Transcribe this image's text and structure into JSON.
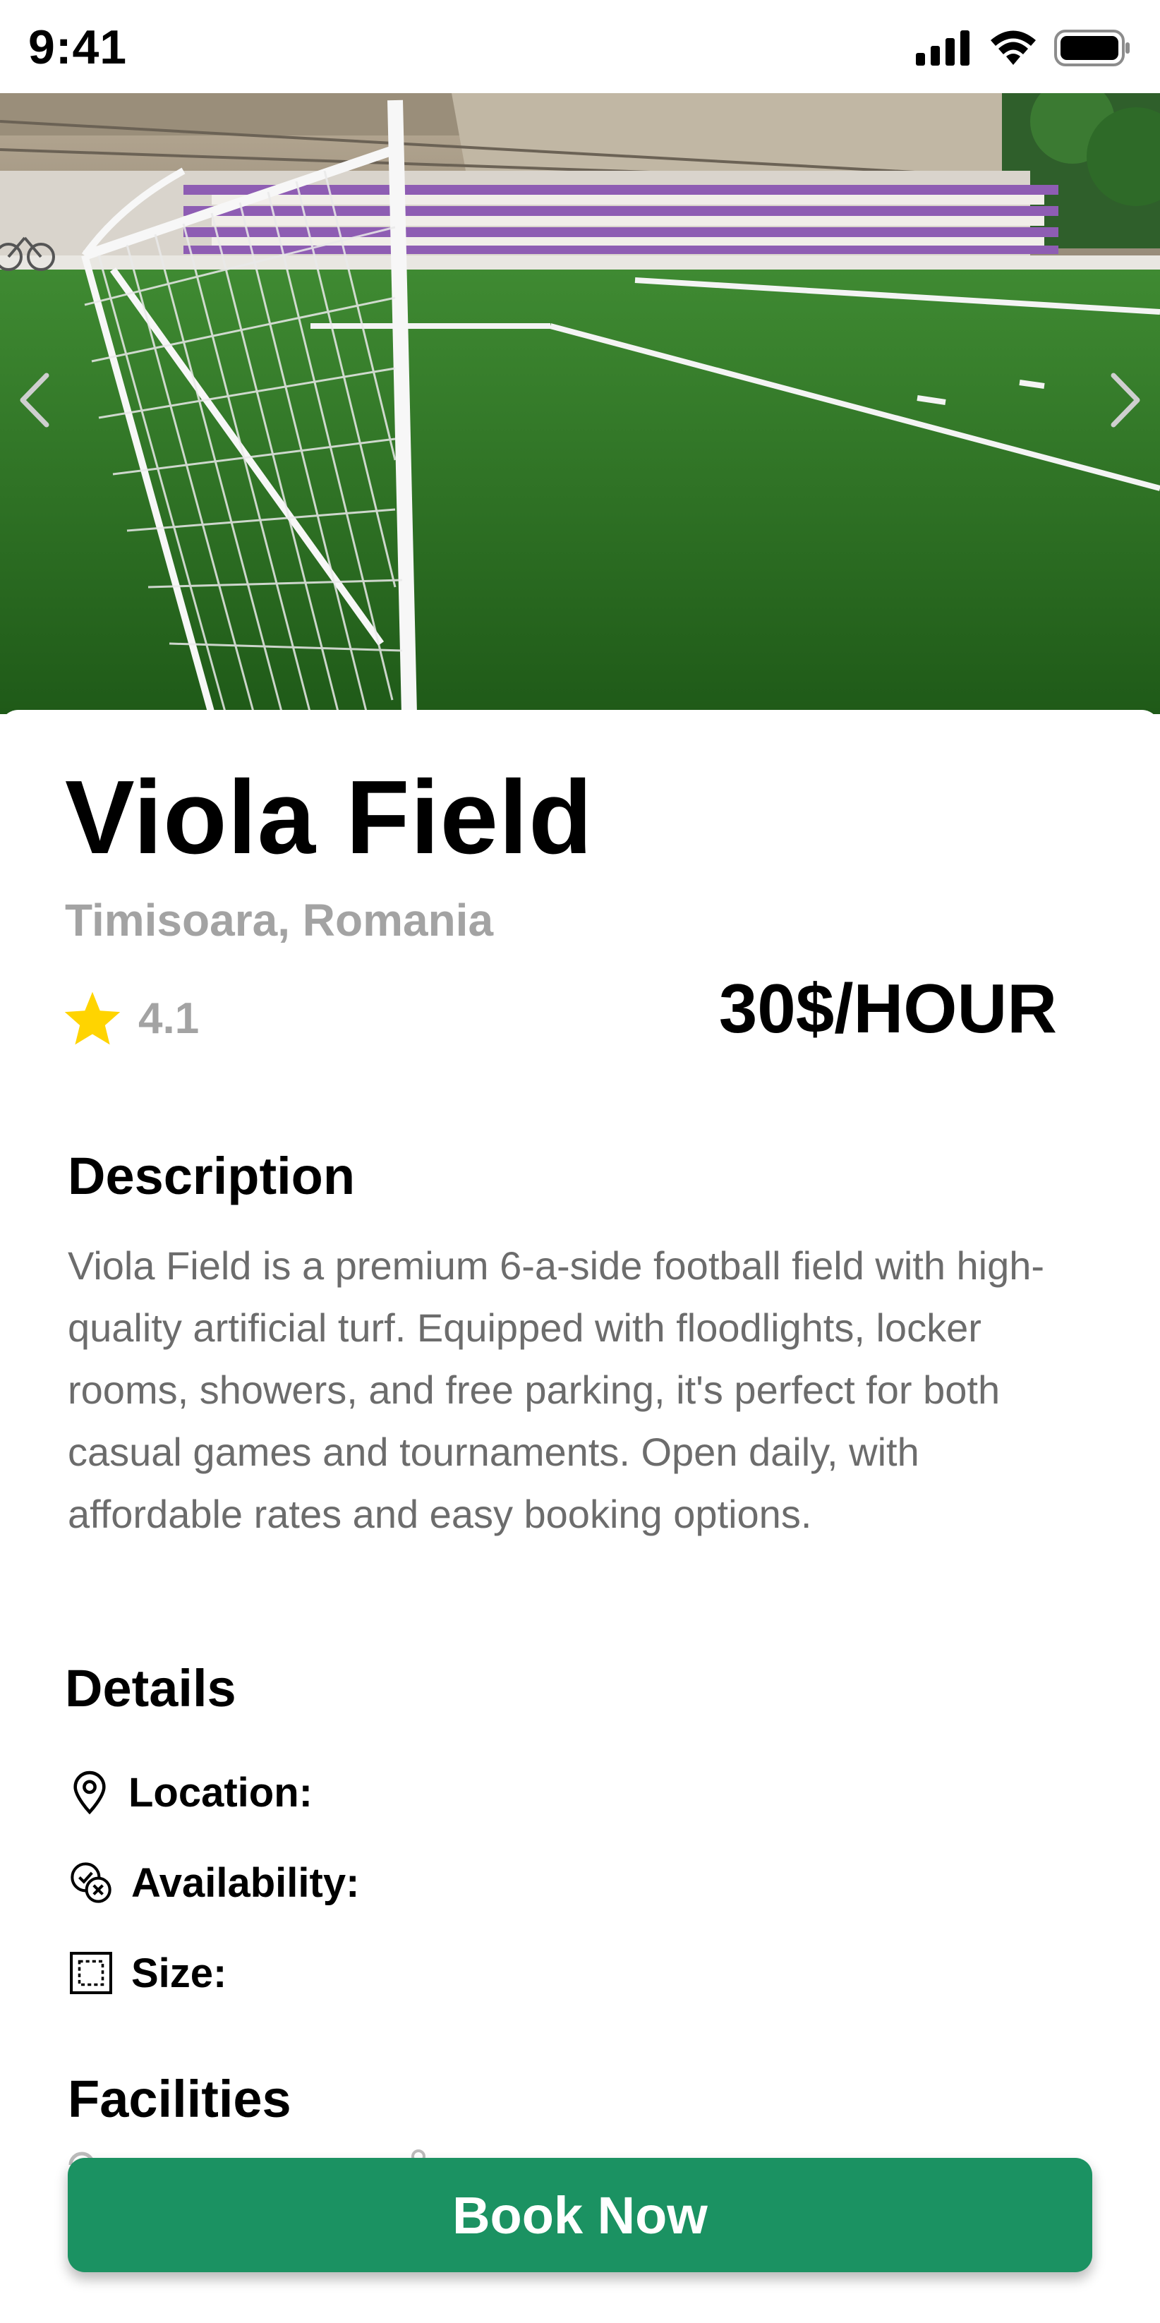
{
  "status_bar": {
    "time": "9:41",
    "icons": [
      "cellular-signal-icon",
      "wifi-icon",
      "battery-icon"
    ]
  },
  "hero": {
    "image_description_icon": "football-field-photo",
    "prev_icon": "chevron-left-icon",
    "next_icon": "chevron-right-icon"
  },
  "field": {
    "name": "Viola Field",
    "location": "Timisoara, Romania",
    "rating": "4.1",
    "price": "30$/HOUR"
  },
  "description": {
    "heading": "Description",
    "text": "Viola Field is a premium 6-a-side football field with high-quality artificial turf. Equipped with floodlights, locker rooms, showers, and free parking, it's perfect for both casual games and tournaments. Open daily, with affordable rates and easy booking options."
  },
  "details": {
    "heading": "Details",
    "items": [
      {
        "icon": "location-pin-icon",
        "label": "Location:"
      },
      {
        "icon": "availability-icon",
        "label": "Availability:"
      },
      {
        "icon": "size-icon",
        "label": "Size:"
      }
    ]
  },
  "facilities": {
    "heading": "Facilities"
  },
  "cta": {
    "label": "Book Now"
  },
  "colors": {
    "primary_green": "#1b9262",
    "muted_text": "#a3a3a3",
    "body_text": "#6c6c6c",
    "star": "#FFD400"
  }
}
